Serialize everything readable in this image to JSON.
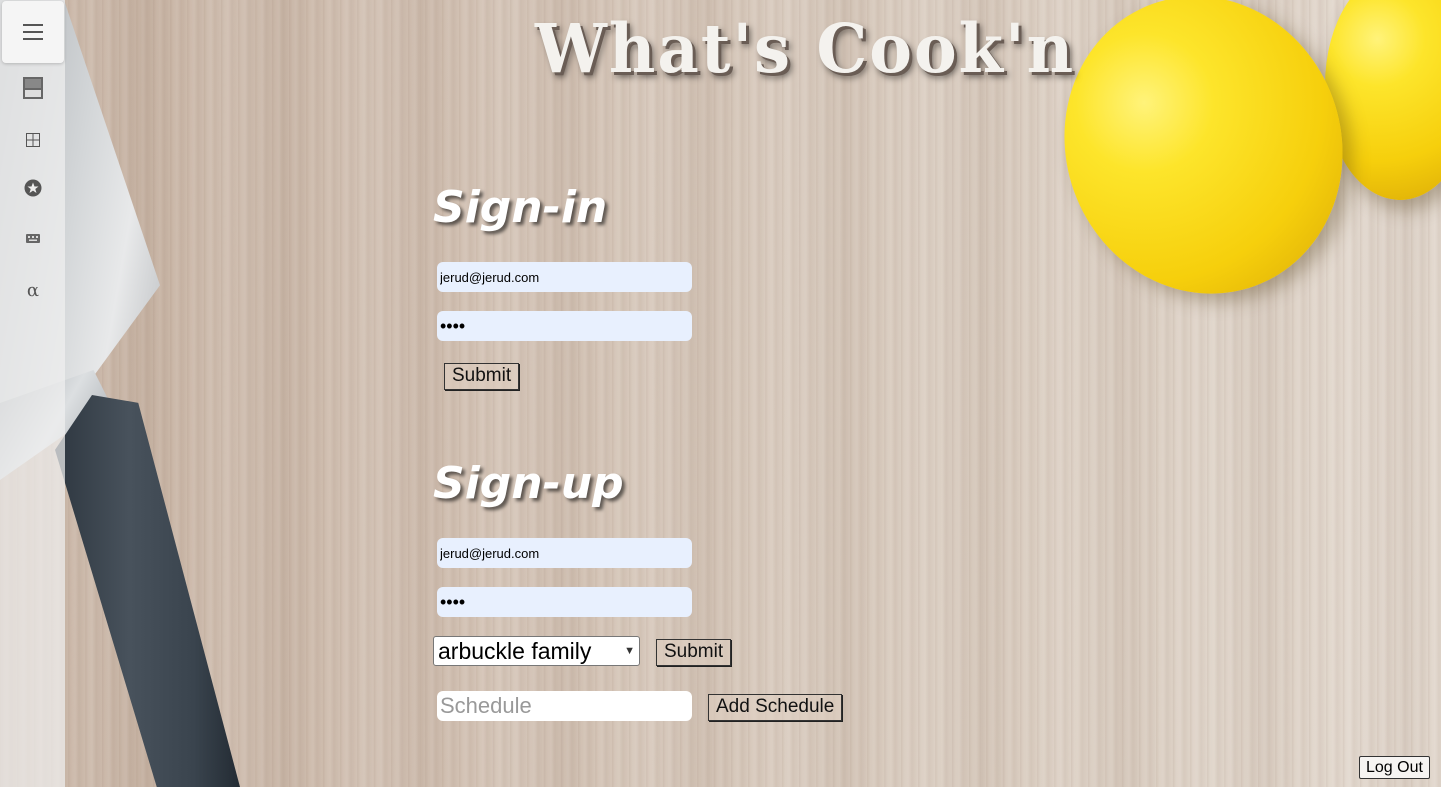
{
  "app": {
    "title": "What's Cook'n"
  },
  "sidebar": {
    "icons": [
      "menu-icon",
      "save-icon",
      "grid-icon",
      "star-icon",
      "keyboard-icon",
      "alpha-icon"
    ]
  },
  "signin": {
    "heading": "Sign-in",
    "email_value": "jerud@jerud.com",
    "password_value": "••••",
    "submit_label": "Submit"
  },
  "signup": {
    "heading": "Sign-up",
    "email_value": "jerud@jerud.com",
    "password_value": "••••",
    "family_selected": "arbuckle family",
    "submit_label": "Submit",
    "schedule_placeholder": "Schedule",
    "add_schedule_label": "Add Schedule"
  },
  "footer": {
    "logout_label": "Log Out"
  }
}
